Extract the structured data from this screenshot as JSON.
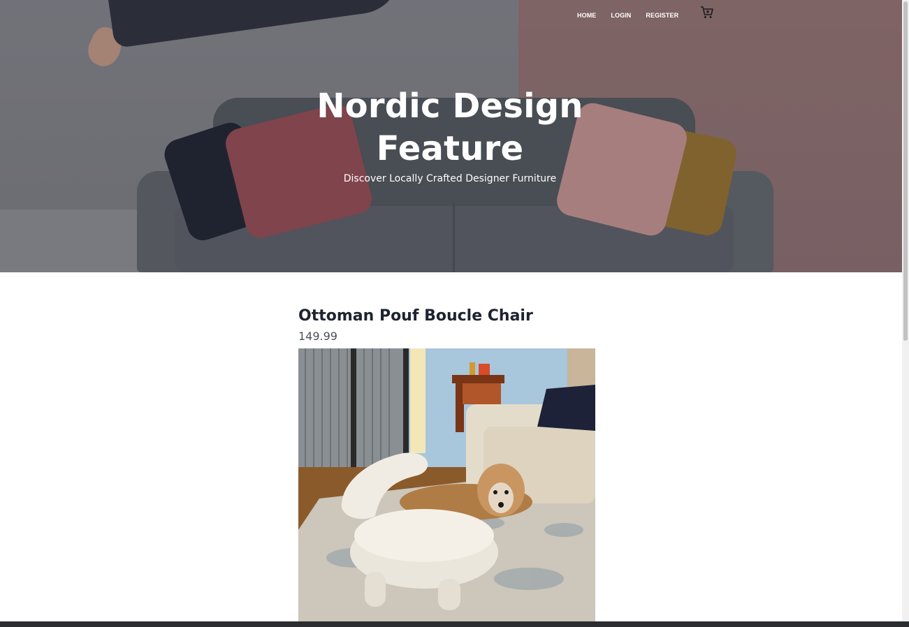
{
  "nav": {
    "items": [
      {
        "label": "HOME"
      },
      {
        "label": "LOGIN"
      },
      {
        "label": "REGISTER"
      }
    ],
    "cart_icon": "shopping-cart-icon"
  },
  "hero": {
    "title": "Nordic Design Feature",
    "subtitle": "Discover Locally Crafted Designer Furniture"
  },
  "product": {
    "name": "Ottoman Pouf Boucle Chair",
    "price": "149.99"
  }
}
